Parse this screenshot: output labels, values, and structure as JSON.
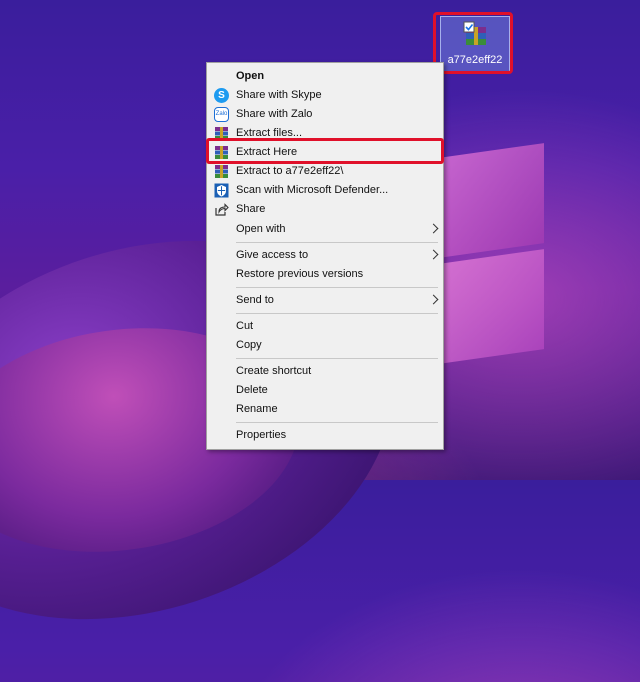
{
  "desktop": {
    "icon": {
      "label": "a77e2eff22",
      "icon": "winrar-archive-icon"
    }
  },
  "context_menu": {
    "items": [
      {
        "label": "Open",
        "bold": true,
        "icon": ""
      },
      {
        "label": "Share with Skype",
        "icon": "skype-icon"
      },
      {
        "label": "Share with Zalo",
        "icon": "zalo-icon"
      },
      {
        "label": "Extract files...",
        "icon": "winrar-icon"
      },
      {
        "label": "Extract Here",
        "icon": "winrar-icon",
        "highlighted": true
      },
      {
        "label": "Extract to a77e2eff22\\",
        "icon": "winrar-icon"
      },
      {
        "label": "Scan with Microsoft Defender...",
        "icon": "defender-icon"
      },
      {
        "label": "Share",
        "icon": "share-icon"
      },
      {
        "label": "Open with",
        "icon": "",
        "submenu": true
      },
      {
        "label": "Give access to",
        "icon": "",
        "submenu": true
      },
      {
        "label": "Restore previous versions",
        "icon": ""
      },
      {
        "label": "Send to",
        "icon": "",
        "submenu": true
      },
      {
        "label": "Cut",
        "icon": ""
      },
      {
        "label": "Copy",
        "icon": ""
      },
      {
        "label": "Create shortcut",
        "icon": ""
      },
      {
        "label": "Delete",
        "icon": ""
      },
      {
        "label": "Rename",
        "icon": ""
      },
      {
        "label": "Properties",
        "icon": ""
      }
    ]
  },
  "colors": {
    "highlight_border": "#e0102a",
    "menu_background": "#f0f0f0"
  }
}
